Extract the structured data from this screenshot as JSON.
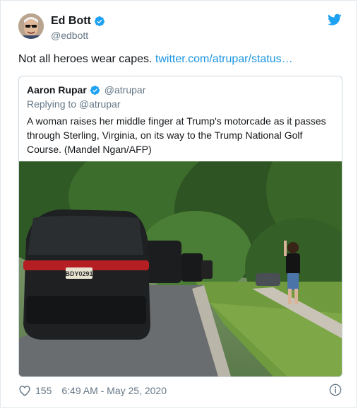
{
  "author": {
    "name": "Ed Bott",
    "handle": "@edbott"
  },
  "tweet": {
    "text": "Not all heroes wear capes.",
    "link": "twitter.com/atrupar/status…"
  },
  "quoted": {
    "name": "Aaron Rupar",
    "handle": "@atrupar",
    "reply_to": "Replying to @atrupar",
    "text": "A woman raises her middle finger at Trump's motorcade as it passes through Sterling, Virginia, on its way to the Trump National Golf Course. (Mandel Ngan/AFP)",
    "plate": "BDY0291"
  },
  "footer": {
    "likes": "155",
    "timestamp": "6:49 AM - May 25, 2020"
  },
  "colors": {
    "accent": "#1b95e0",
    "verified": "#1da1f2",
    "muted": "#657786",
    "like": "#e0245e"
  },
  "icons": {
    "verified": "verified-badge-icon",
    "bird": "twitter-bird-icon",
    "like": "heart-icon",
    "info": "info-icon"
  }
}
